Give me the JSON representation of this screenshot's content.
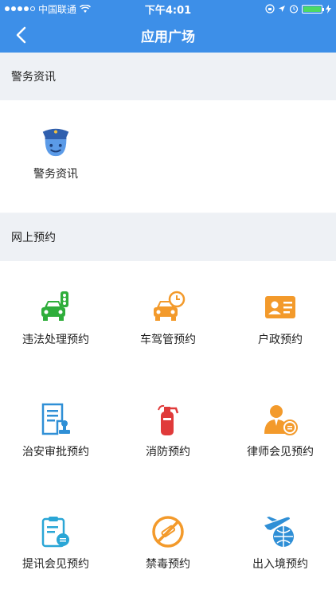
{
  "status_bar": {
    "carrier": "中国联通",
    "time": "下午4:01",
    "battery_level": 1.0
  },
  "nav": {
    "title": "应用广场"
  },
  "sections": [
    {
      "title": "警务资讯",
      "items": [
        {
          "label": "警务资讯",
          "icon": "police-icon"
        }
      ]
    },
    {
      "title": "网上预约",
      "items": [
        {
          "label": "违法处理预约",
          "icon": "car-traffic-light-icon"
        },
        {
          "label": "车驾管预约",
          "icon": "car-clock-icon"
        },
        {
          "label": "户政预约",
          "icon": "id-card-icon"
        },
        {
          "label": "治安审批预约",
          "icon": "document-stamp-icon"
        },
        {
          "label": "消防预约",
          "icon": "fire-extinguisher-icon"
        },
        {
          "label": "律师会见预约",
          "icon": "lawyer-icon"
        },
        {
          "label": "提讯会见预约",
          "icon": "clipboard-meeting-icon"
        },
        {
          "label": "禁毒预约",
          "icon": "no-drugs-icon"
        },
        {
          "label": "出入境预约",
          "icon": "airplane-globe-icon"
        }
      ]
    }
  ],
  "colors": {
    "nav": "#3d8fe8",
    "green": "#2fae3b",
    "orange": "#f39a2b",
    "blue": "#2f8fd6",
    "red": "#e03a3a"
  }
}
